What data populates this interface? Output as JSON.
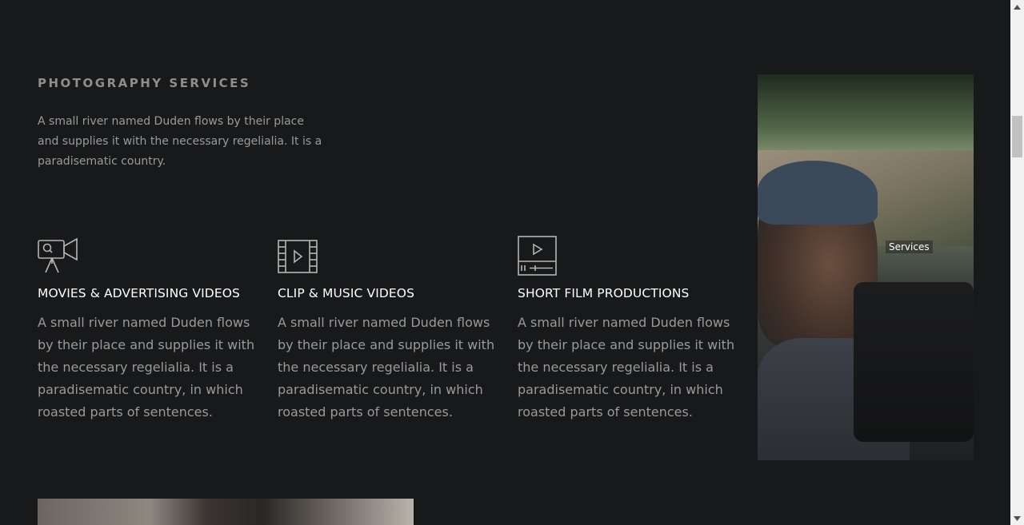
{
  "section": {
    "title": "PHOTOGRAPHY SERVICES",
    "intro": "A small river named Duden flows by their place and supplies it with the necessary regelialia. It is a paradisematic country."
  },
  "services": [
    {
      "icon": "movie-camera-icon",
      "title": "MOVIES & ADVERTISING VIDEOS",
      "text": "A small river named Duden flows by their place and supplies it with the necessary regelialia. It is a paradisematic country, in which roasted parts of sentences."
    },
    {
      "icon": "film-strip-icon",
      "title": "CLIP & MUSIC VIDEOS",
      "text": "A small river named Duden flows by their place and supplies it with the necessary regelialia. It is a paradisematic country, in which roasted parts of sentences."
    },
    {
      "icon": "video-player-icon",
      "title": "SHORT FILM PRODUCTIONS",
      "text": "A small river named Duden flows by their place and supplies it with the necessary regelialia. It is a paradisematic country, in which roasted parts of sentences."
    }
  ],
  "photo": {
    "label": "Services"
  },
  "colors": {
    "background": "#18191b",
    "heading": "#8e8e8e",
    "body_text": "#9a9a9a",
    "service_title": "#ffffff"
  }
}
